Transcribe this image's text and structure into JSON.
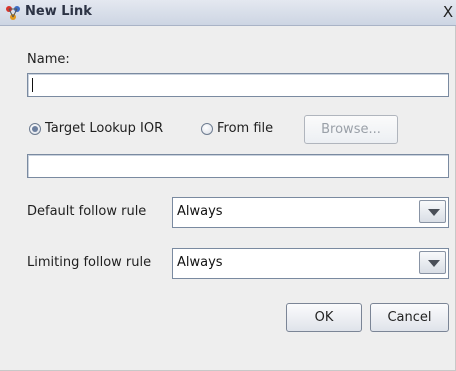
{
  "window": {
    "title": "New Link",
    "close_glyph": "X",
    "icon": "network-icon"
  },
  "name_field": {
    "label": "Name:",
    "value": ""
  },
  "target": {
    "option_lookup_label": "Target Lookup IOR",
    "option_file_label": "From file",
    "selected": "Target Lookup IOR",
    "browse_label": "Browse...",
    "browse_enabled": false,
    "ior_value": ""
  },
  "default_follow_rule": {
    "label": "Default follow rule",
    "value": "Always"
  },
  "limiting_follow_rule": {
    "label": "Limiting follow rule",
    "value": "Always"
  },
  "buttons": {
    "ok_label": "OK",
    "cancel_label": "Cancel"
  },
  "colors": {
    "background": "#eeeeee",
    "title_gradient_top": "#e4e8f0",
    "title_gradient_bottom": "#cdd5e3",
    "radio_dot": "#6c7f9e"
  }
}
